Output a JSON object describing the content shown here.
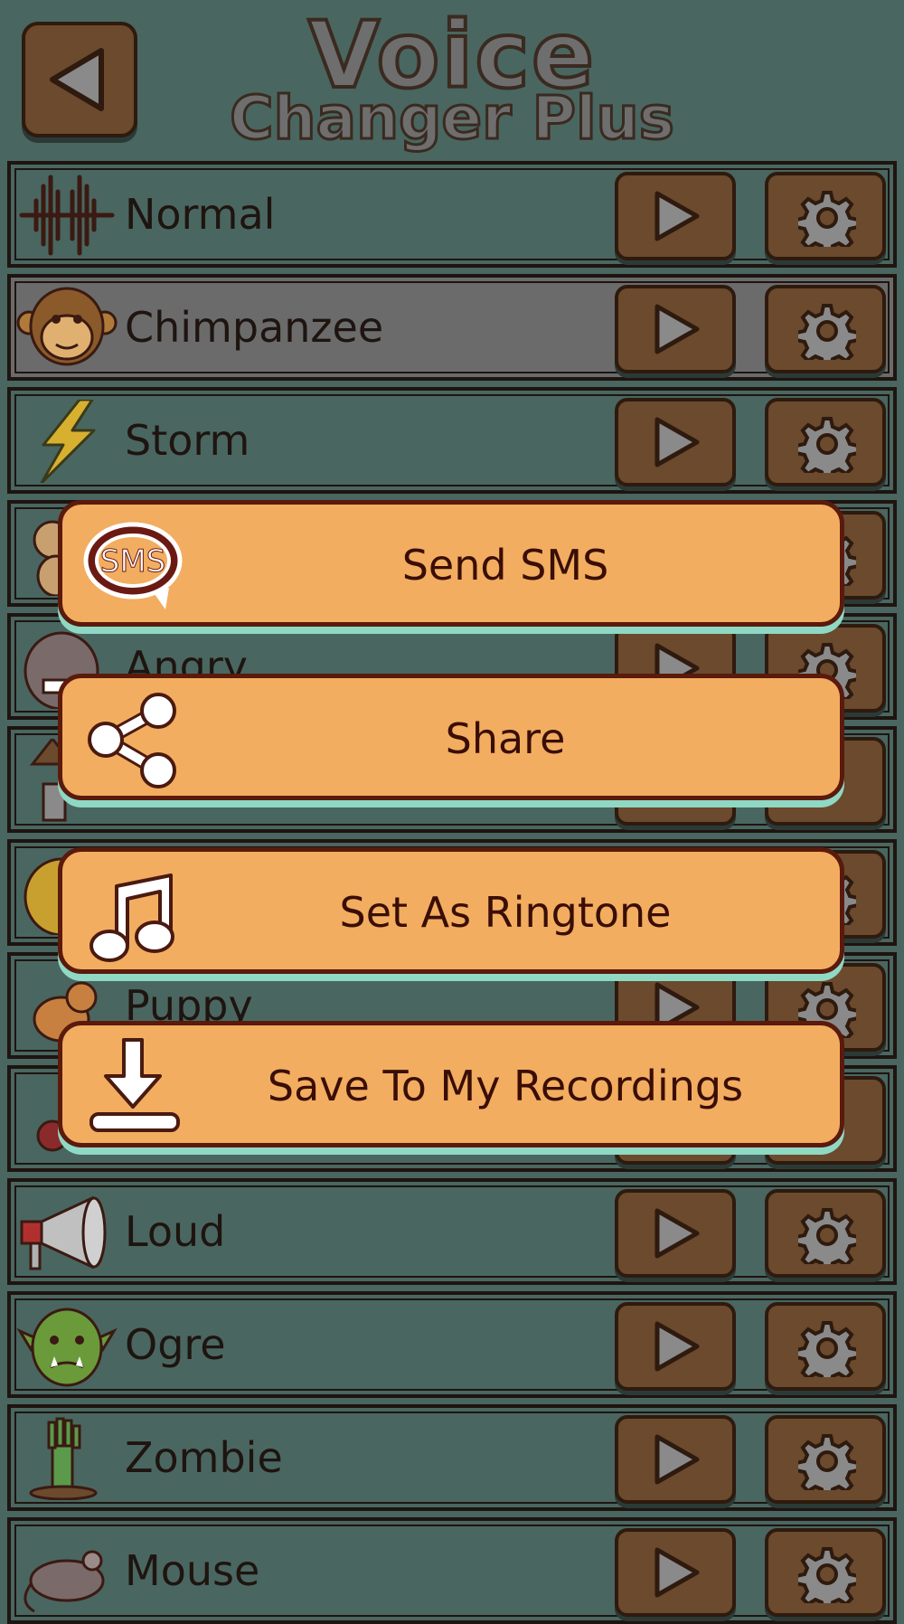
{
  "header": {
    "title_line1": "Voice",
    "title_line2": "Changer Plus"
  },
  "voices": [
    {
      "label": "Normal",
      "icon": "soundwave-icon"
    },
    {
      "label": "Chimpanzee",
      "icon": "monkey-icon",
      "selected": true
    },
    {
      "label": "Storm",
      "icon": "lightning-icon"
    },
    {
      "label": "",
      "icon": "teddy-bear-icon"
    },
    {
      "label": "Angry",
      "icon": "angry-face-icon"
    },
    {
      "label": "",
      "icon": "well-icon"
    },
    {
      "label": "",
      "icon": "face-icon"
    },
    {
      "label": "Puppy",
      "icon": "puppy-icon"
    },
    {
      "label": "",
      "icon": "spider-icon"
    },
    {
      "label": "Loud",
      "icon": "megaphone-icon"
    },
    {
      "label": "Ogre",
      "icon": "ogre-icon"
    },
    {
      "label": "Zombie",
      "icon": "zombie-hand-icon"
    },
    {
      "label": "Mouse",
      "icon": "mouse-icon"
    }
  ],
  "popup": {
    "items": [
      {
        "label": "Send SMS",
        "icon": "sms-icon"
      },
      {
        "label": "Share",
        "icon": "share-icon"
      },
      {
        "label": "Set As Ringtone",
        "icon": "music-note-icon"
      },
      {
        "label": "Save To My Recordings",
        "icon": "download-icon"
      }
    ]
  },
  "colors": {
    "background": "#4a6660",
    "button_brown": "#6b4a2d",
    "popup_orange": "#f2ad60",
    "popup_shadow": "#8fd8c4",
    "selected_row": "#6b6b6b"
  }
}
